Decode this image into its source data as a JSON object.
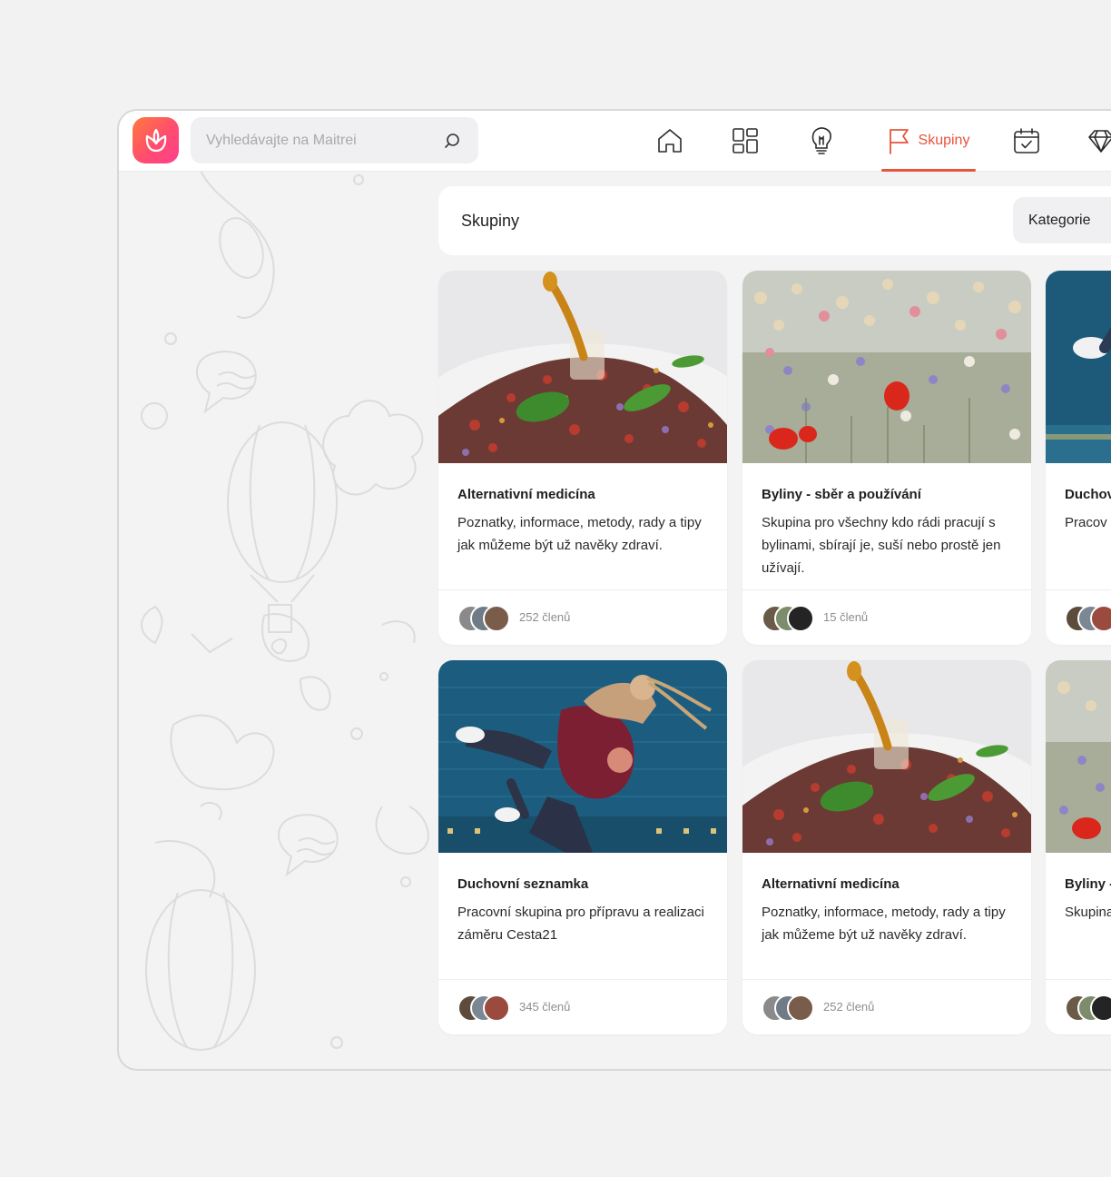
{
  "search": {
    "placeholder": "Vyhledávajte na Maitrei"
  },
  "nav": {
    "items": [
      {
        "icon": "home-icon"
      },
      {
        "icon": "grid-icon"
      },
      {
        "icon": "lightbulb-icon"
      },
      {
        "icon": "flag-icon",
        "label": "Skupiny",
        "active": true
      },
      {
        "icon": "calendar-check-icon"
      },
      {
        "icon": "diamond-icon"
      }
    ]
  },
  "panel": {
    "title": "Skupiny",
    "filter_label": "Kategorie"
  },
  "cards": [
    {
      "title": "Alternativní medicína",
      "desc": "Poznatky, informace, metody, rady a tipy jak můžeme být už navěky zdraví.",
      "members": "252 členů",
      "image": "herbs"
    },
    {
      "title": "Byliny - sběr a používání",
      "desc": "Skupina pro všechny kdo rádi pracují s bylinami, sbírají je, suší nebo prostě jen užívají.",
      "members": "15 členů",
      "image": "flowers"
    },
    {
      "title": "Duchov",
      "desc": "Pracov realizac",
      "members": "",
      "image": "couple"
    },
    {
      "title": "Duchovní seznamka",
      "desc": "Pracovní skupina pro přípravu a realizaci záměru Cesta21",
      "members": "345 členů",
      "image": "couple"
    },
    {
      "title": "Alternativní medicína",
      "desc": "Poznatky, informace, metody, rady a tipy jak můžeme být už navěky zdraví.",
      "members": "252 členů",
      "image": "herbs"
    },
    {
      "title": "Byliny -",
      "desc": "Skupina s byline jen užív",
      "members": "",
      "image": "flowers"
    }
  ],
  "colors": {
    "accent": "#e9533c",
    "logo_start": "#ff7a3d",
    "logo_end": "#ff3f8f"
  }
}
